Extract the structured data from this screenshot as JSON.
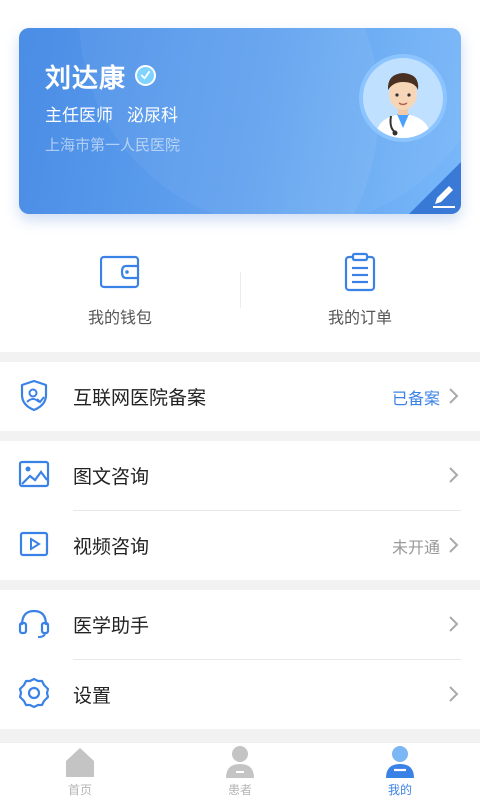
{
  "profile": {
    "name": "刘达康",
    "position": "主任医师",
    "department": "泌尿科",
    "hospital": "上海市第一人民医院"
  },
  "quick_actions": [
    {
      "label": "我的钱包",
      "icon": "wallet-icon"
    },
    {
      "label": "我的订单",
      "icon": "clipboard-icon"
    }
  ],
  "menu": {
    "filing": {
      "label": "互联网医院备案",
      "status": "已备案",
      "icon": "shield-user-icon"
    },
    "image_consult": {
      "label": "图文咨询",
      "status": "",
      "icon": "image-icon"
    },
    "video_consult": {
      "label": "视频咨询",
      "status": "未开通",
      "icon": "video-play-icon"
    },
    "assistant": {
      "label": "医学助手",
      "status": "",
      "icon": "headset-icon"
    },
    "settings": {
      "label": "设置",
      "status": "",
      "icon": "gear-icon"
    }
  },
  "tabs": [
    {
      "label": "首页",
      "icon": "home-icon",
      "active": false
    },
    {
      "label": "患者",
      "icon": "patient-icon",
      "active": false
    },
    {
      "label": "我的",
      "icon": "profile-icon",
      "active": true
    }
  ],
  "colors": {
    "accent": "#3b82e6",
    "card_start": "#3f86e4",
    "card_end": "#79b8f9"
  }
}
